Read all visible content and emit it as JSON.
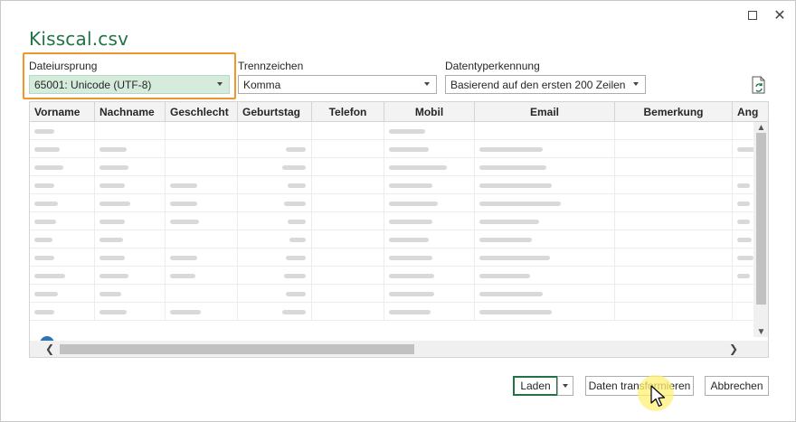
{
  "window": {
    "title": "Kisscal.csv",
    "maximize_icon": "maximize-icon",
    "close_icon": "close-icon",
    "close_glyph": "✕"
  },
  "options": {
    "file_origin": {
      "label": "Dateiursprung",
      "value": "65001: Unicode (UTF-8)"
    },
    "delimiter": {
      "label": "Trennzeichen",
      "value": "Komma"
    },
    "type_detection": {
      "label": "Datentyperkennung",
      "value": "Basierend auf den ersten 200 Zeilen"
    },
    "refresh_icon": "refresh-document-icon"
  },
  "table": {
    "columns": [
      "Vorname",
      "Nachname",
      "Geschlecht",
      "Geburtstag",
      "Telefon",
      "Mobil",
      "Email",
      "Bemerkung",
      "Ang"
    ]
  },
  "scroll_glyphs": {
    "up": "▲",
    "down": "▼",
    "left": "❮",
    "right": "❯"
  },
  "buttons": {
    "load": "Laden",
    "transform": "Daten transformieren",
    "cancel": "Abbrechen"
  },
  "colors": {
    "accent_green": "#217346",
    "highlight_orange": "#f0962a",
    "selected_dropdown_bg": "#d5ecdd"
  }
}
